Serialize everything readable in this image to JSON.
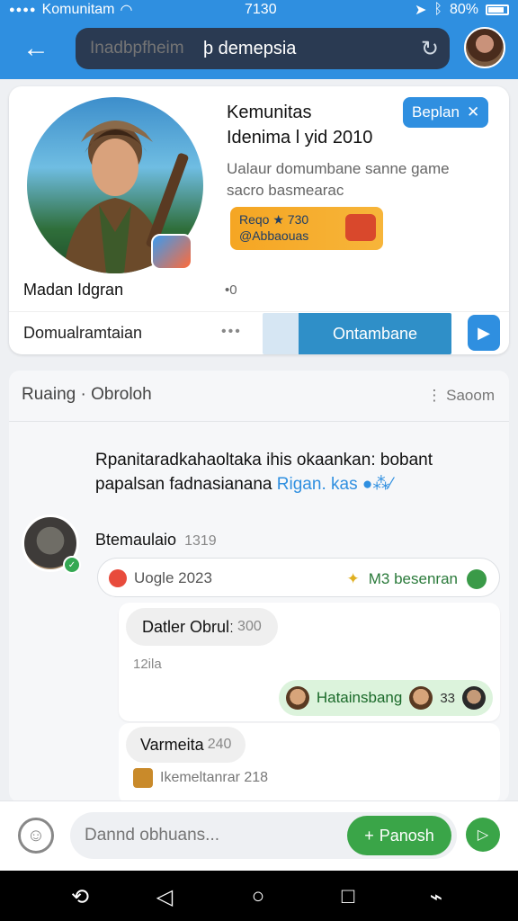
{
  "status_bar": {
    "carrier": "Komunitam",
    "time": "7130",
    "battery": "80%"
  },
  "top_bar": {
    "search_placeholder": "Inadbpfheim",
    "search_query": "þ demepsia"
  },
  "community_card": {
    "title": "Kemunitas",
    "subtitle": "Idenima l yid 2010",
    "tag_label": "Beplan",
    "description": "Ualaur domumbane sanne game sacro basmearac",
    "banner_line1": "Reqo ★ 730",
    "banner_line2": "@Abbaouas",
    "owner_name": "Madan Idgran",
    "member_count": "•0",
    "footer_label": "Domualramtaian",
    "join_label": "Ontambane"
  },
  "chat": {
    "header_title": "Ruaing · Obroloh",
    "header_right": "⋮ Saoom",
    "announcement_text": "Rpanitaradkahaoltaka ihis okaankan: bobant papalsan fadnasianana ",
    "announcement_link": "Rigan. kas",
    "message": {
      "author": "Btemaulaio",
      "time": "1319",
      "reply_left": "Uogle 2023",
      "reply_right": "M3 besenran"
    },
    "thread1": {
      "title": "Datler Obrulː",
      "count": "300",
      "meta": "12ila",
      "participants_label": "Hatainsbang",
      "participants_count": "33"
    },
    "thread2": {
      "title": "Varmeita",
      "count": "240",
      "sub": "Ikemeltanrar 218"
    }
  },
  "composer": {
    "placeholder": "Dannd obhuans...",
    "post_label": "Panosh"
  },
  "icons": [
    "back-arrow-icon",
    "refresh-icon",
    "close-icon",
    "play-icon",
    "emoji-icon",
    "plus-icon",
    "send-icon",
    "nav-back-icon",
    "nav-home-icon",
    "nav-recents-icon",
    "nav-assist-icon"
  ]
}
